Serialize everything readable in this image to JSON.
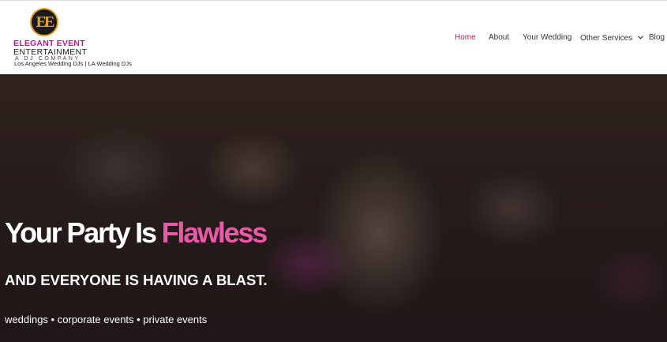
{
  "logo": {
    "mark": "EE",
    "line1": "ELEGANT EVENT",
    "line2": "ENTERTAINMENT",
    "line3": "A DJ COMPANY",
    "tagline": "Los Angeles Wedding DJs | LA Wedding DJs"
  },
  "nav": {
    "items": [
      {
        "label": "Home",
        "active": true
      },
      {
        "label": "About"
      },
      {
        "label": "Your Wedding"
      },
      {
        "label": "Other Services",
        "icon": "chevron-down-icon"
      },
      {
        "label": "Blog"
      }
    ]
  },
  "hero": {
    "title_main": "Your Party Is ",
    "title_accent": "Flawless",
    "subtitle": "AND EVERYONE IS HAVING A BLAST.",
    "events": "weddings • corporate events • private events"
  },
  "colors": {
    "brand_pink": "#c2188c",
    "nav_active": "#c2185b",
    "hero_accent": "#e85aa8",
    "logo_gold": "#e8a020"
  }
}
